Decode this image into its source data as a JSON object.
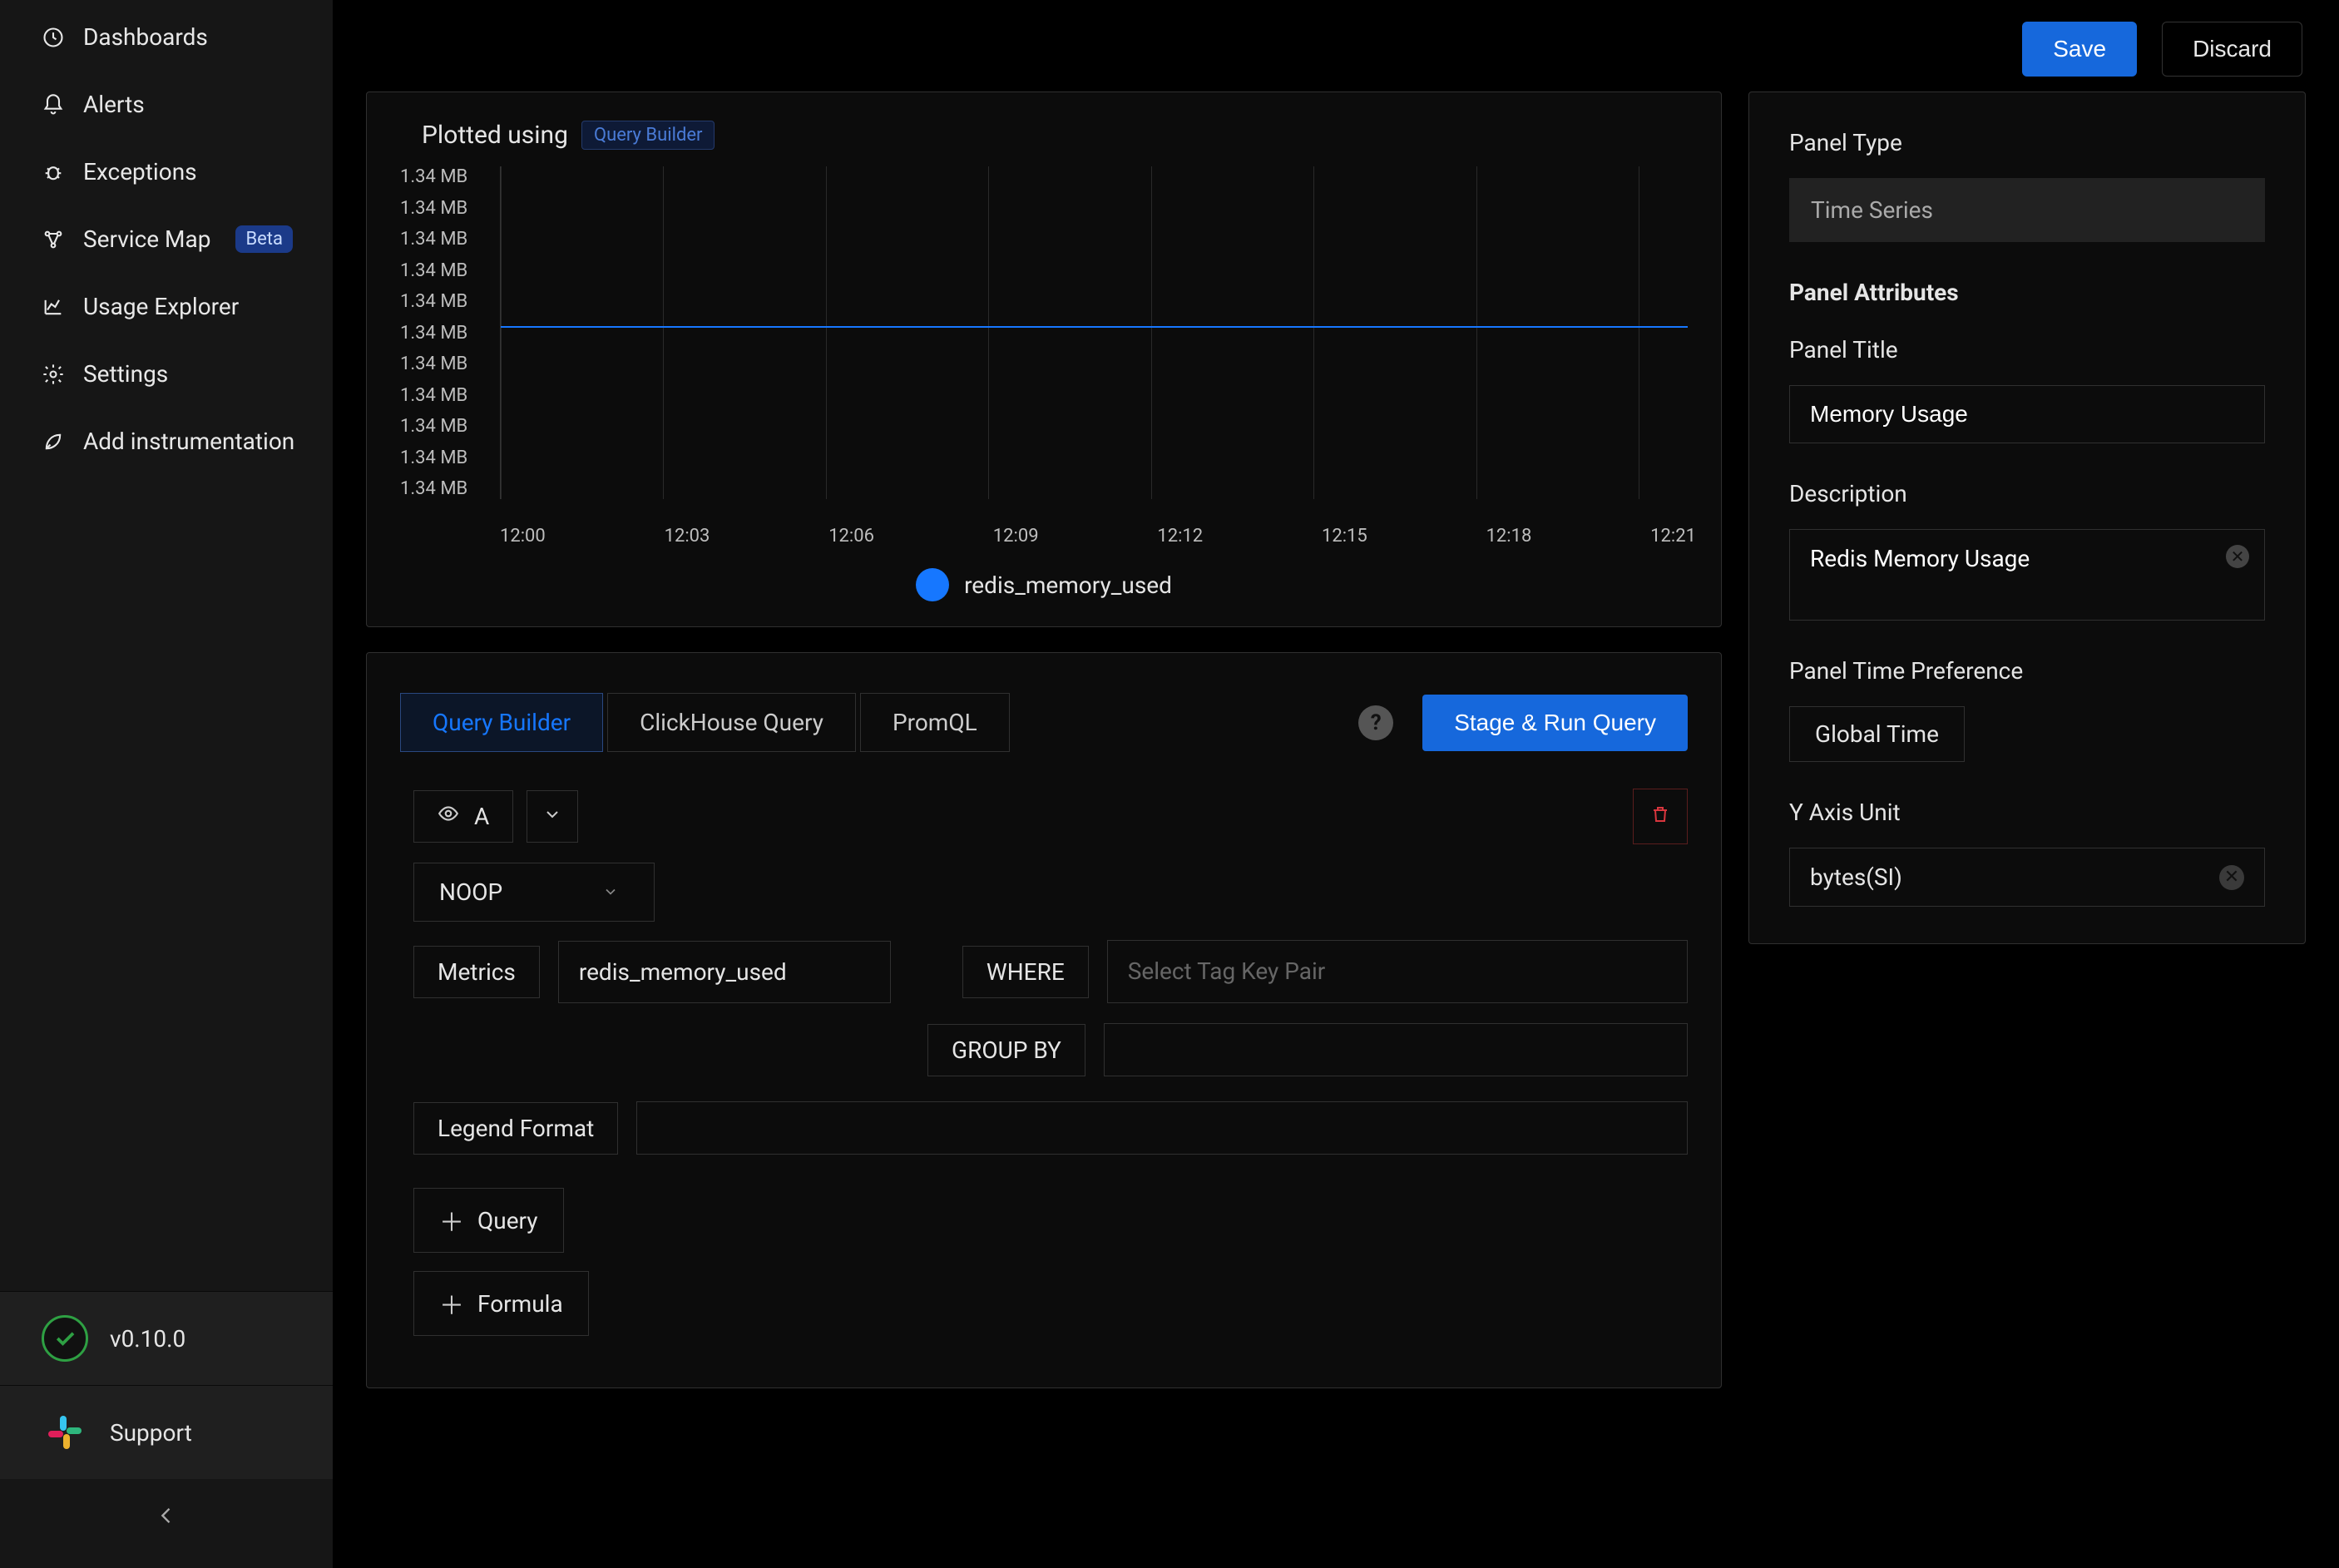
{
  "sidebar": {
    "items": [
      {
        "label": "Dashboards"
      },
      {
        "label": "Alerts"
      },
      {
        "label": "Exceptions"
      },
      {
        "label": "Service Map",
        "badge": "Beta"
      },
      {
        "label": "Usage Explorer"
      },
      {
        "label": "Settings"
      },
      {
        "label": "Add instrumentation"
      }
    ],
    "version": "v0.10.0",
    "support": "Support"
  },
  "topbar": {
    "save": "Save",
    "discard": "Discard"
  },
  "chart_header": {
    "title": "Plotted using",
    "chip": "Query Builder"
  },
  "chart_data": {
    "type": "line",
    "title": "",
    "xlabel": "",
    "ylabel": "",
    "y_ticks": [
      "1.34 MB",
      "1.34 MB",
      "1.34 MB",
      "1.34 MB",
      "1.34 MB",
      "1.34 MB",
      "1.34 MB",
      "1.34 MB",
      "1.34 MB",
      "1.34 MB",
      "1.34 MB"
    ],
    "x_ticks": [
      "12:00",
      "12:03",
      "12:06",
      "12:09",
      "12:12",
      "12:15",
      "12:18",
      "12:21"
    ],
    "series": [
      {
        "name": "redis_memory_used",
        "color": "#1677ff",
        "x": [
          "12:00",
          "12:03",
          "12:06",
          "12:09",
          "12:12",
          "12:15",
          "12:18",
          "12:21"
        ],
        "values": [
          1.34,
          1.34,
          1.34,
          1.34,
          1.34,
          1.34,
          1.34,
          1.34
        ],
        "unit": "MB"
      }
    ],
    "ylim_display": "1.34 MB"
  },
  "builder": {
    "tabs": {
      "qb": "Query Builder",
      "ch": "ClickHouse Query",
      "prom": "PromQL"
    },
    "run": "Stage & Run Query",
    "query_letter": "A",
    "agg": "NOOP",
    "metrics_label": "Metrics",
    "metric_value": "redis_memory_used",
    "where_label": "WHERE",
    "where_placeholder": "Select Tag Key Pair",
    "group_by_label": "GROUP BY",
    "legend_label": "Legend Format",
    "add_query": "Query",
    "add_formula": "Formula"
  },
  "panel": {
    "type_label": "Panel Type",
    "type_value": "Time Series",
    "attrs_label": "Panel Attributes",
    "title_label": "Panel Title",
    "title_value": "Memory Usage",
    "desc_label": "Description",
    "desc_value": "Redis Memory Usage",
    "time_pref_label": "Panel Time Preference",
    "time_pref_value": "Global Time",
    "y_unit_label": "Y Axis Unit",
    "y_unit_value": "bytes(SI)"
  }
}
